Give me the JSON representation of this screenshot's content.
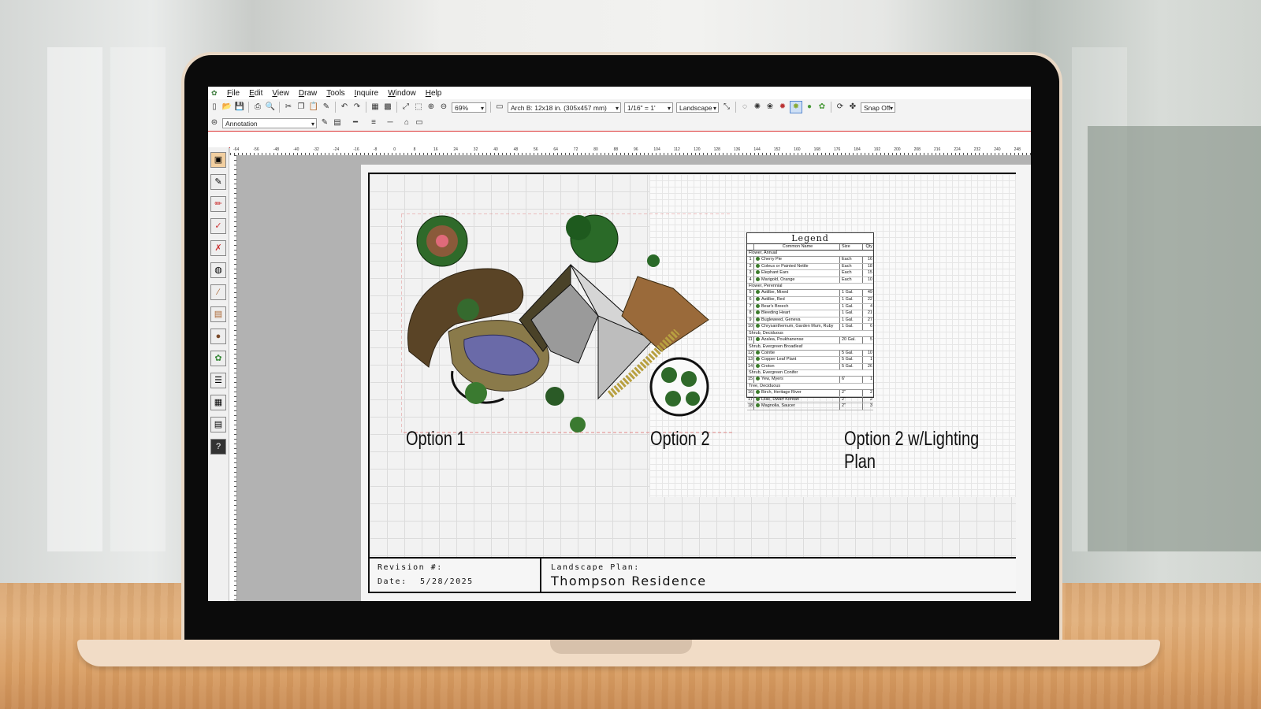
{
  "menu": {
    "items": [
      "File",
      "Edit",
      "View",
      "Draw",
      "Tools",
      "Inquire",
      "Window",
      "Help"
    ]
  },
  "toolbar": {
    "zoom": "69%",
    "paper_size": "Arch B: 12x18 in. (305x457 mm)",
    "scale": "1/16\" = 1'",
    "orientation": "Landscape",
    "snap": "Snap Off",
    "layer": "Annotation"
  },
  "ruler": {
    "labels": [
      "-64",
      "-56",
      "-48",
      "-40",
      "-32",
      "-24",
      "-16",
      "-8",
      "0",
      "8",
      "16",
      "24",
      "32",
      "40",
      "48",
      "56",
      "64",
      "72",
      "80",
      "88",
      "96",
      "104",
      "112",
      "120",
      "128",
      "136",
      "144",
      "152",
      "160",
      "168",
      "176",
      "184",
      "192",
      "200",
      "208",
      "216",
      "224",
      "232",
      "240",
      "248"
    ]
  },
  "drawing": {
    "option1": "Option 1",
    "option2": "Option 2",
    "option3": "Option 2 w/Lighting Plan"
  },
  "legend": {
    "title": "Legend",
    "headers": [
      "Common Name",
      "Size",
      "Qty"
    ],
    "groups": [
      {
        "name": "Flower, Annual",
        "rows": [
          {
            "n": "1",
            "name": "Cherry Pie",
            "size": "Each",
            "qty": "16"
          },
          {
            "n": "2",
            "name": "Coleus or Painted Nettle",
            "size": "Each",
            "qty": "18"
          },
          {
            "n": "3",
            "name": "Elephant Ears",
            "size": "Each",
            "qty": "15"
          },
          {
            "n": "4",
            "name": "Marigold, Orange",
            "size": "Each",
            "qty": "10"
          }
        ]
      },
      {
        "name": "Flower, Perennial",
        "rows": [
          {
            "n": "5",
            "name": "Astilbe, Mixed",
            "size": "1 Gal.",
            "qty": "49"
          },
          {
            "n": "6",
            "name": "Astilbe, Red",
            "size": "1 Gal.",
            "qty": "22"
          },
          {
            "n": "7",
            "name": "Bear's Breech",
            "size": "1 Gal.",
            "qty": "4"
          },
          {
            "n": "8",
            "name": "Bleeding Heart",
            "size": "1 Gal.",
            "qty": "21"
          },
          {
            "n": "9",
            "name": "Bugleweed, Geneva",
            "size": "1 Gal.",
            "qty": "27"
          },
          {
            "n": "10",
            "name": "Chrysanthemum, Garden Mum, Ruby",
            "size": "1 Gal.",
            "qty": "6"
          }
        ]
      },
      {
        "name": "Shrub, Deciduous",
        "rows": [
          {
            "n": "11",
            "name": "Azalea, Poukhanense",
            "size": "20 Gal.",
            "qty": "5"
          }
        ]
      },
      {
        "name": "Shrub, Evergreen Broadleaf",
        "rows": [
          {
            "n": "12",
            "name": "Cointie",
            "size": "5 Gal.",
            "qty": "10"
          },
          {
            "n": "13",
            "name": "Copper Leaf Plant",
            "size": "5 Gal.",
            "qty": "1"
          },
          {
            "n": "14",
            "name": "Croton",
            "size": "5 Gal.",
            "qty": "26"
          }
        ]
      },
      {
        "name": "Shrub, Evergreen Conifer",
        "rows": [
          {
            "n": "15",
            "name": "Yew, Myers",
            "size": "6'",
            "qty": "1"
          }
        ]
      },
      {
        "name": "Tree, Deciduous",
        "rows": [
          {
            "n": "16",
            "name": "Birch, Heritage River",
            "size": "2\"",
            "qty": "2"
          },
          {
            "n": "17",
            "name": "Lilac, Dwarf Korean",
            "size": "2\"",
            "qty": "2"
          },
          {
            "n": "18",
            "name": "Magnolia, Saucer",
            "size": "2\"",
            "qty": "3"
          }
        ]
      }
    ]
  },
  "titleblock": {
    "revision_label": "Revision #:",
    "date_label": "Date:",
    "date_value": "5/28/2025",
    "plan_label": "Landscape Plan:",
    "plan_name": "Thompson Residence"
  }
}
